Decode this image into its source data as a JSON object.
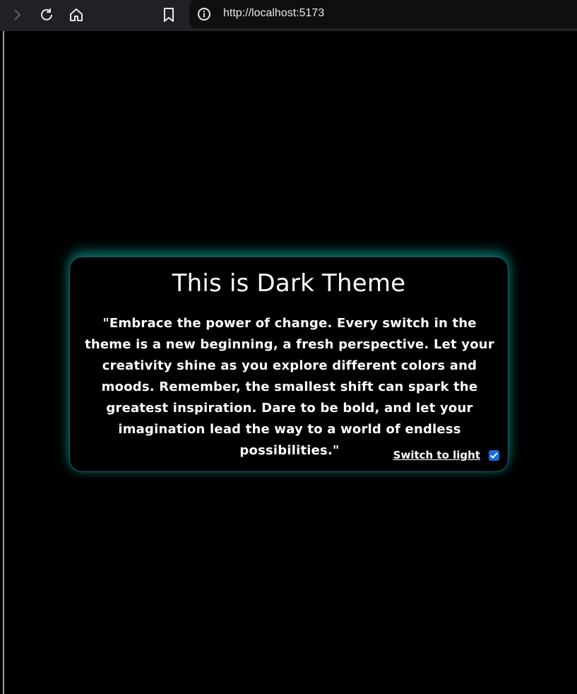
{
  "browser": {
    "url": "http://localhost:5173",
    "icons": [
      "chevron-right-icon",
      "reload-icon",
      "home-icon",
      "bookmark-icon",
      "info-icon"
    ]
  },
  "card": {
    "title": "This is Dark Theme",
    "quote": "\"Embrace the power of change. Every switch in the theme is a new beginning, a fresh perspective. Let your creativity shine as you explore different colors and moods. Remember, the smallest shift can spark the greatest inspiration. Dare to be bold, and let your imagination lead the way to a world of endless possibilities.\"",
    "switch_label": "Switch to light",
    "switch_checked": true
  },
  "colors": {
    "background": "#000000",
    "card_glow": "#0aaaa0",
    "text": "#ffffff",
    "checkbox": "#1769e0"
  }
}
